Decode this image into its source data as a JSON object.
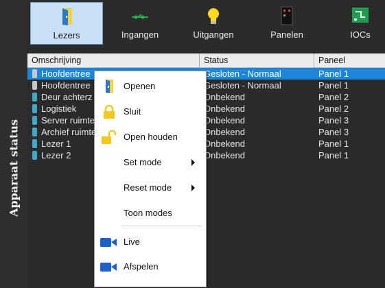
{
  "sidebar": {
    "title": "Apparaat status"
  },
  "toolbar": {
    "items": [
      {
        "label": "Lezers",
        "icon": "reader-door-icon",
        "active": true
      },
      {
        "label": "Ingangen",
        "icon": "input-connector-icon"
      },
      {
        "label": "Uitgangen",
        "icon": "lightbulb-icon"
      },
      {
        "label": "Panelen",
        "icon": "panel-icon"
      },
      {
        "label": "IOCs",
        "icon": "io-board-icon"
      }
    ]
  },
  "table": {
    "columns": [
      "Omschrijving",
      "Status",
      "Paneel"
    ],
    "rows": [
      {
        "name": "Hoofdentree",
        "status": "Gesloten - Normaal",
        "panel": "Panel 1",
        "selected": true
      },
      {
        "name": "Hoofdentree",
        "status": "Gesloten - Normaal",
        "panel": "Panel 1"
      },
      {
        "name": "Deur achterz",
        "status": "Onbekend",
        "panel": "Panel 2"
      },
      {
        "name": "Logistiek",
        "status": "Onbekend",
        "panel": "Panel 2"
      },
      {
        "name": "Server ruimte",
        "status": "Onbekend",
        "panel": "Panel 3"
      },
      {
        "name": "Archief ruimte",
        "status": "Onbekend",
        "panel": "Panel 3"
      },
      {
        "name": "Lezer 1",
        "status": "Onbekend",
        "panel": "Panel 1"
      },
      {
        "name": "Lezer 2",
        "status": "Onbekend",
        "panel": "Panel 1"
      }
    ]
  },
  "context_menu": {
    "items": [
      {
        "label": "Openen",
        "icon": "door-open-icon"
      },
      {
        "label": "Sluit",
        "icon": "lock-closed-icon"
      },
      {
        "label": "Open houden",
        "icon": "lock-open-icon"
      },
      {
        "label": "Set mode",
        "submenu": true
      },
      {
        "label": "Reset mode",
        "submenu": true
      },
      {
        "label": "Toon modes"
      },
      {
        "label": "Live",
        "icon": "video-camera-icon"
      },
      {
        "label": "Afspelen",
        "icon": "video-camera-icon"
      }
    ]
  },
  "colors": {
    "selection": "#1d86d8",
    "active_tab": "#c9e0f7",
    "accent_yellow": "#f2c81a",
    "camera_blue": "#1f5fc8"
  }
}
